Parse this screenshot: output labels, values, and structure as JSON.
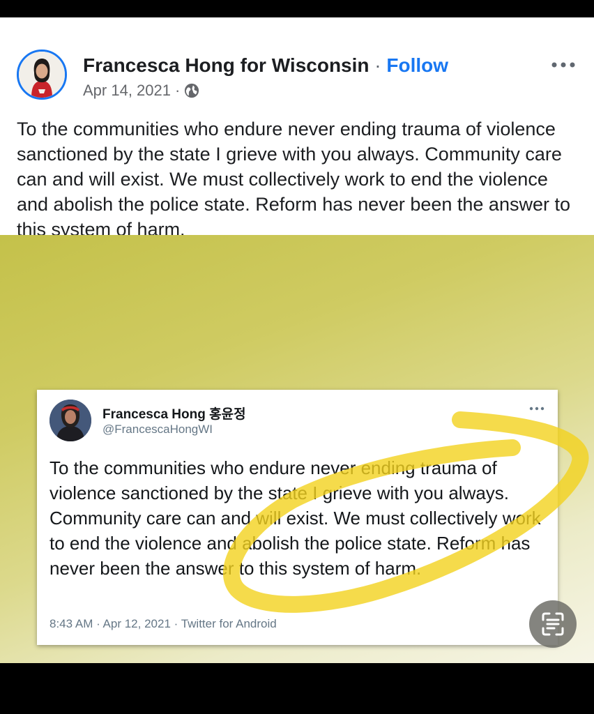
{
  "post": {
    "page_name": "Francesca Hong for Wisconsin",
    "separator": "·",
    "follow_label": "Follow",
    "date": "Apr 14, 2021",
    "date_separator": "·",
    "privacy_icon": "globe-icon",
    "more_icon": "more-horizontal-icon",
    "text": "To the communities who endure never ending trauma of violence sanctioned by the state I grieve with you always. Community care can and will exist. We must collectively work to end the violence and abolish the police state. Reform has never been the answer to this system of harm."
  },
  "tweet": {
    "name": "Francesca Hong 홍윤정",
    "handle": "@FrancescaHongWI",
    "more_icon": "more-horizontal-icon",
    "text": "To the communities who endure never ending trauma of violence sanctioned by the state I grieve with you always. Community care can and will exist. We must collectively work to end the violence and abolish the police state. Reform has never been the answer to this system of harm.",
    "footer": "8:43 AM · Apr 12, 2021 · Twitter for Android"
  },
  "overlay": {
    "scan_icon": "text-scan-icon"
  },
  "colors": {
    "link_blue": "#1877f2",
    "image_background": "#c4c14a",
    "highlight_yellow": "#f3d21e"
  }
}
